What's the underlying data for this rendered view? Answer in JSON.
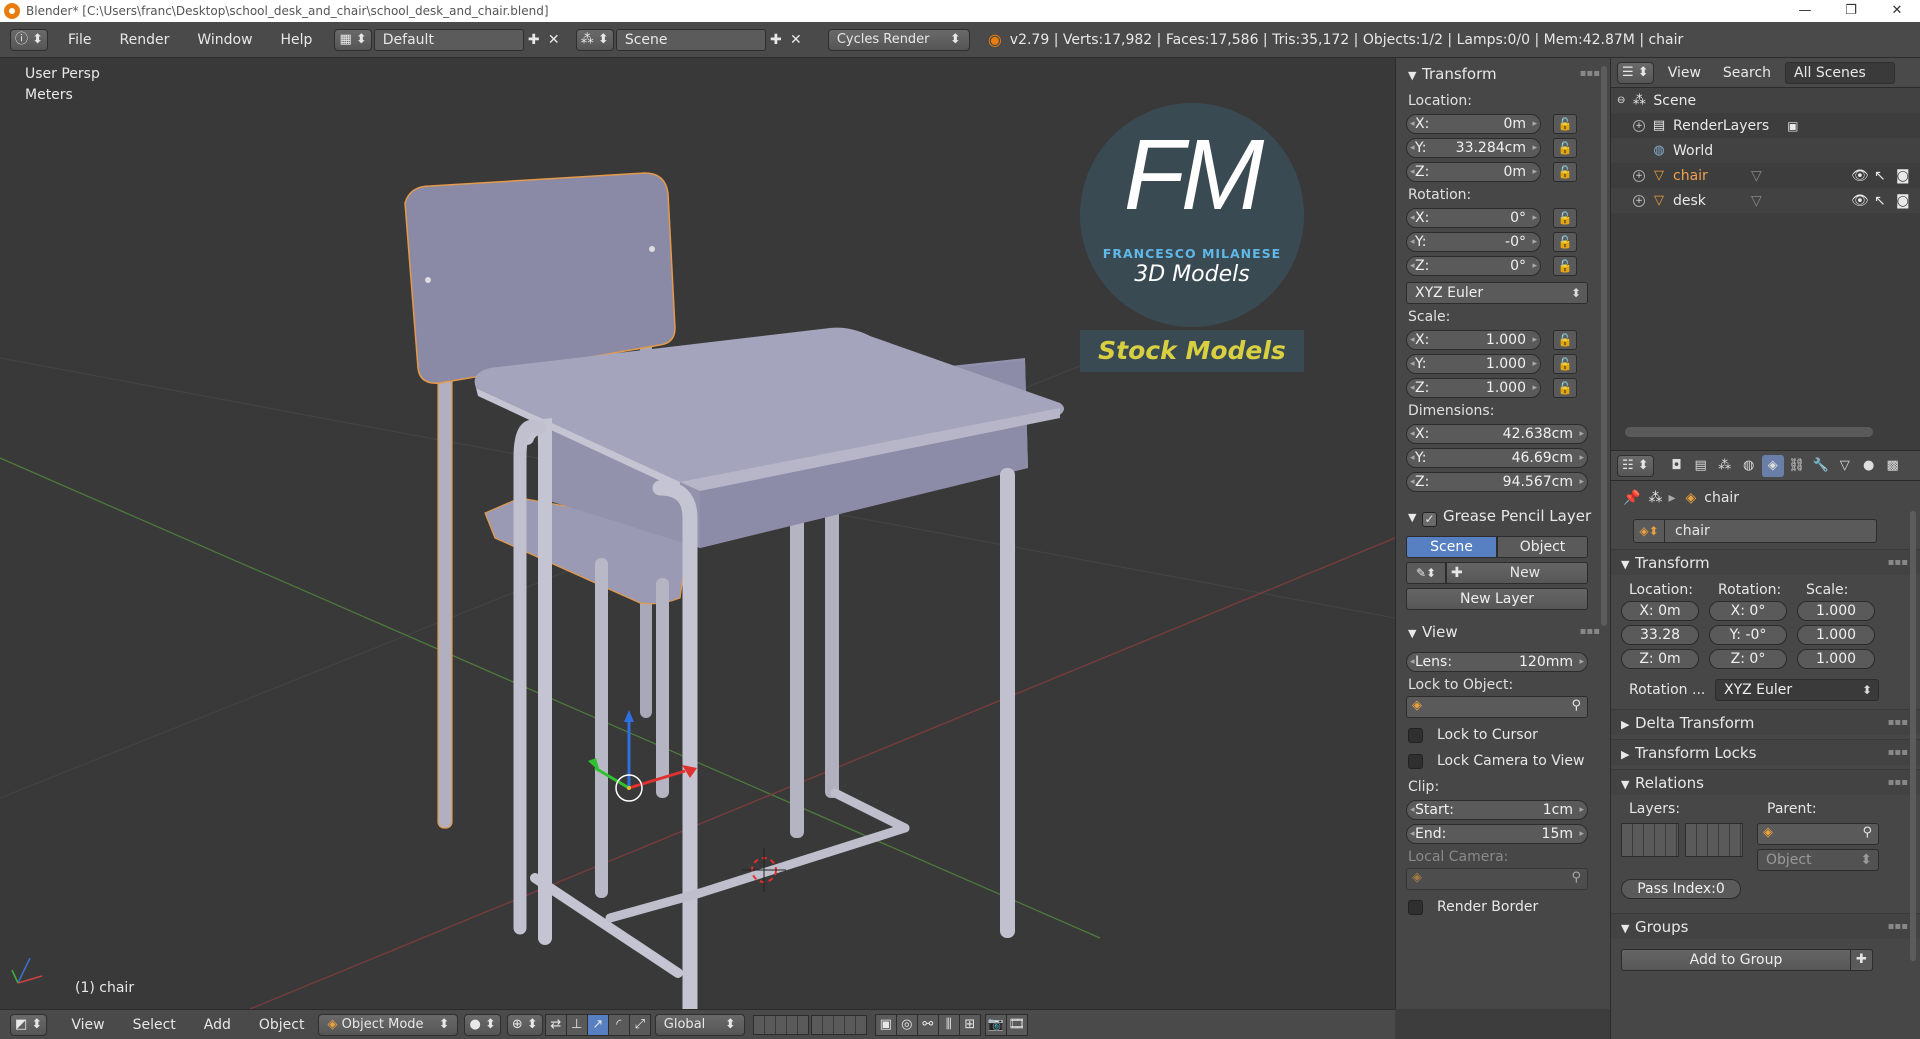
{
  "titlebar": {
    "title": "Blender* [C:\\Users\\franc\\Desktop\\school_desk_and_chair\\school_desk_and_chair.blend]",
    "minimize": "—",
    "maximize": "❐",
    "close": "✕"
  },
  "topbar": {
    "menus": [
      "File",
      "Render",
      "Window",
      "Help"
    ],
    "layout": "Default",
    "scene": "Scene",
    "engine": "Cycles Render",
    "stats": "v2.79 | Verts:17,982 | Faces:17,586 | Tris:35,172 | Objects:1/2 | Lamps:0/0 | Mem:42.87M | chair"
  },
  "viewport": {
    "view_name": "User Persp",
    "units": "Meters",
    "active_object": "(1) chair",
    "watermark": {
      "logo": "FM",
      "name": "FRANCESCO MILANESE",
      "sub": "3D Models",
      "banner": "Stock Models"
    }
  },
  "npanel": {
    "transform": {
      "title": "Transform",
      "location_label": "Location:",
      "location": [
        {
          "axis": "X:",
          "value": "0m"
        },
        {
          "axis": "Y:",
          "value": "33.284cm"
        },
        {
          "axis": "Z:",
          "value": "0m"
        }
      ],
      "rotation_label": "Rotation:",
      "rotation": [
        {
          "axis": "X:",
          "value": "0°"
        },
        {
          "axis": "Y:",
          "value": "-0°"
        },
        {
          "axis": "Z:",
          "value": "0°"
        }
      ],
      "rotation_mode": "XYZ Euler",
      "scale_label": "Scale:",
      "scale": [
        {
          "axis": "X:",
          "value": "1.000"
        },
        {
          "axis": "Y:",
          "value": "1.000"
        },
        {
          "axis": "Z:",
          "value": "1.000"
        }
      ],
      "dimensions_label": "Dimensions:",
      "dimensions": [
        {
          "axis": "X:",
          "value": "42.638cm"
        },
        {
          "axis": "Y:",
          "value": "46.69cm"
        },
        {
          "axis": "Z:",
          "value": "94.567cm"
        }
      ]
    },
    "grease_pencil": {
      "title": "Grease Pencil Layer",
      "scene_tab": "Scene",
      "object_tab": "Object",
      "new_label": "New",
      "new_layer_label": "New Layer"
    },
    "view": {
      "title": "View",
      "lens_label": "Lens:",
      "lens_value": "120mm",
      "lock_object_label": "Lock to Object:",
      "lock_cursor": "Lock to Cursor",
      "lock_camera": "Lock Camera to View",
      "clip_label": "Clip:",
      "clip_start_label": "Start:",
      "clip_start": "1cm",
      "clip_end_label": "End:",
      "clip_end": "15m",
      "local_camera_label": "Local Camera:",
      "render_border": "Render Border"
    }
  },
  "outliner": {
    "view": "View",
    "search": "Search",
    "filter": "All Scenes",
    "items": [
      "Scene",
      "RenderLayers",
      "World",
      "chair",
      "desk"
    ]
  },
  "properties": {
    "breadcrumb_object": "chair",
    "object_name": "chair",
    "transform_title": "Transform",
    "location_label": "Location:",
    "rotation_label": "Rotation:",
    "scale_label": "Scale:",
    "loc": [
      "X: 0m",
      "33.28",
      "Z: 0m"
    ],
    "rot": [
      "X:  0°",
      "Y: -0°",
      "Z:  0°"
    ],
    "scl": [
      "1.000",
      "1.000",
      "1.000"
    ],
    "rotation_mode_label": "Rotation ...",
    "rotation_mode": "XYZ Euler",
    "delta_transform": "Delta Transform",
    "transform_locks": "Transform Locks",
    "relations": "Relations",
    "layers_label": "Layers:",
    "parent_label": "Parent:",
    "parent_type": "Object",
    "pass_index": "Pass Index:0",
    "groups": "Groups",
    "add_to_group": "Add to Group"
  },
  "bottombar": {
    "menus": [
      "View",
      "Select",
      "Add",
      "Object"
    ],
    "mode": "Object Mode",
    "orientation": "Global"
  }
}
